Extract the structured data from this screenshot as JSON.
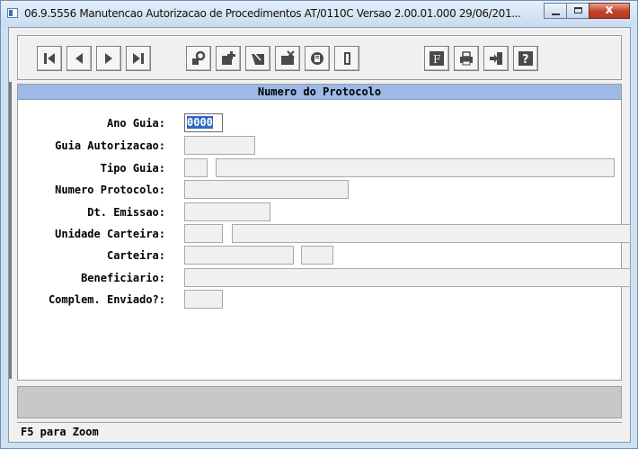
{
  "window": {
    "title": "06.9.5556 Manutencao Autorizacao de Procedimentos AT/0110C Versao 2.00.01.000 29/06/201..."
  },
  "toolbar": {
    "nav_buttons": [
      "first-record",
      "previous-record",
      "next-record",
      "last-record"
    ],
    "action_buttons": [
      "search",
      "add-record",
      "edit-record",
      "delete-record",
      "copy-record",
      "exit-door"
    ],
    "util_buttons": [
      "font-f",
      "print",
      "exit",
      "help"
    ]
  },
  "panel": {
    "header": "Numero do Protocolo"
  },
  "form": {
    "ano_guia": {
      "label": "Ano Guia:",
      "value": "0000"
    },
    "guia_autorizacao": {
      "label": "Guia Autorizacao:",
      "value": ""
    },
    "tipo_guia": {
      "label": "Tipo Guia:",
      "code": "",
      "desc": ""
    },
    "numero_protocolo": {
      "label": "Numero Protocolo:",
      "value": ""
    },
    "dt_emissao": {
      "label": "Dt. Emissao:",
      "value": ""
    },
    "unidade_carteira": {
      "label": "Unidade Carteira:",
      "code": "",
      "desc": ""
    },
    "carteira": {
      "label": "Carteira:",
      "value": "",
      "digit": ""
    },
    "beneficiario": {
      "label": "Beneficiario:",
      "value": ""
    },
    "complem_enviado": {
      "label": "Complem. Enviado?:",
      "value": ""
    }
  },
  "status": {
    "text": "F5 para Zoom"
  },
  "colors": {
    "header_bg": "#9db9e5",
    "selection": "#3169c6",
    "close_button": "#c0412a"
  }
}
